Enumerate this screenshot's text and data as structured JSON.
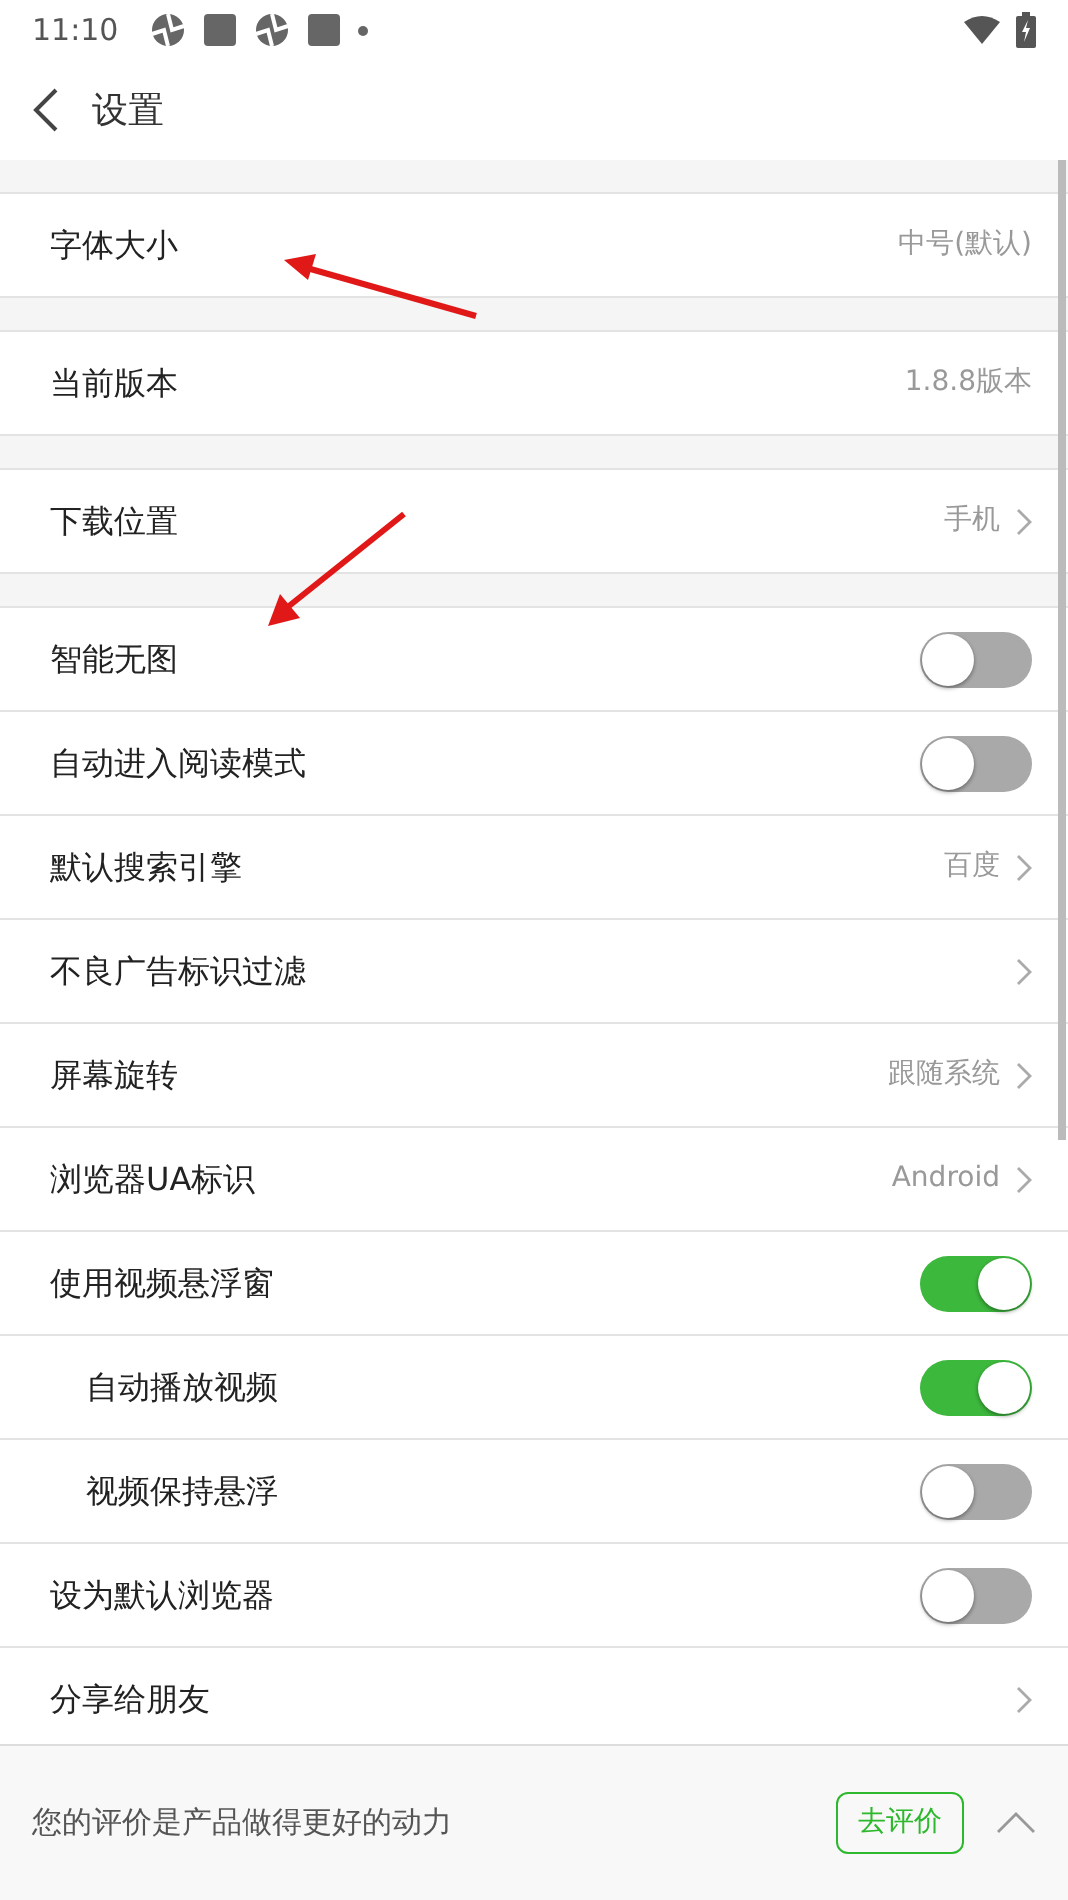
{
  "status_bar": {
    "time": "11:10"
  },
  "header": {
    "title": "设置"
  },
  "groups": [
    {
      "items": [
        {
          "kind": "value",
          "label": "字体大小",
          "value": "中号(默认)"
        }
      ]
    },
    {
      "items": [
        {
          "kind": "value",
          "label": "当前版本",
          "value": "1.8.8版本"
        }
      ]
    },
    {
      "items": [
        {
          "kind": "link",
          "label": "下载位置",
          "value": "手机"
        }
      ]
    },
    {
      "items": [
        {
          "kind": "switch",
          "label": "智能无图",
          "on": false
        },
        {
          "kind": "switch",
          "label": "自动进入阅读模式",
          "on": false
        },
        {
          "kind": "link",
          "label": "默认搜索引擎",
          "value": "百度"
        },
        {
          "kind": "link",
          "label": "不良广告标识过滤"
        },
        {
          "kind": "link",
          "label": "屏幕旋转",
          "value": "跟随系统"
        },
        {
          "kind": "link",
          "label": "浏览器UA标识",
          "value": "Android"
        },
        {
          "kind": "switch",
          "label": "使用视频悬浮窗",
          "on": true,
          "children": [
            {
              "kind": "switch",
              "label": "自动播放视频",
              "on": true
            },
            {
              "kind": "switch",
              "label": "视频保持悬浮",
              "on": false
            }
          ]
        },
        {
          "kind": "switch",
          "label": "设为默认浏览器",
          "on": false
        },
        {
          "kind": "link",
          "label": "分享给朋友"
        }
      ]
    }
  ],
  "rating_bar": {
    "text": "您的评价是产品做得更好的动力",
    "button": "去评价"
  }
}
